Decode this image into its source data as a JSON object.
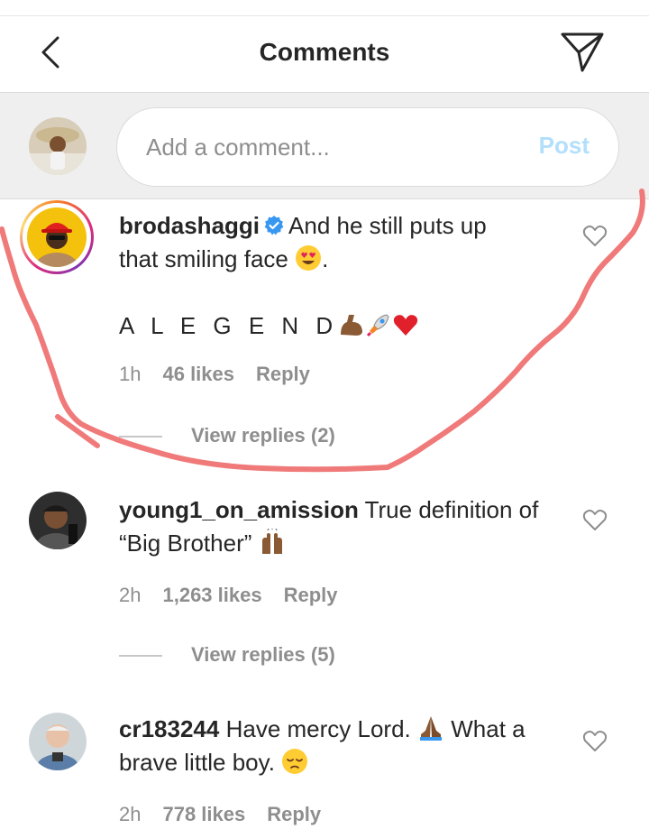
{
  "header": {
    "title": "Comments",
    "back_icon": "chevron-left-icon",
    "send_icon": "paper-plane-icon"
  },
  "composer": {
    "placeholder": "Add a comment...",
    "post_label": "Post",
    "post_color": "#b2dffc"
  },
  "comments": [
    {
      "username": "brodashaggi",
      "verified": true,
      "text_line1": "And he still puts up",
      "text_line2": "that smiling face",
      "text_line2_end": ".",
      "line2_emoji": "heart-eyes-emoji",
      "extra_text": "A L E G E N D",
      "extra_emojis": [
        "flexed-biceps-emoji",
        "rocket-emoji",
        "red-heart-emoji"
      ],
      "time": "1h",
      "likes": "46 likes",
      "reply_label": "Reply",
      "replies_label": "View replies (2)"
    },
    {
      "username": "young1_on_amission",
      "text_line1": "True definition of",
      "text_line2": "“Big Brother”",
      "line2_emoji": "raising-hands-emoji",
      "time": "2h",
      "likes": "1,263 likes",
      "reply_label": "Reply",
      "replies_label": "View replies (5)"
    },
    {
      "username": "cr183244",
      "text_line1": "Have mercy Lord.",
      "text_line1_after": "What a",
      "line1_emoji": "folded-hands-emoji",
      "text_line2": "brave little boy.",
      "line2_emoji": "pensive-face-emoji",
      "time": "2h",
      "likes": "778 likes",
      "reply_label": "Reply"
    }
  ],
  "colors": {
    "text": "#262626",
    "secondary": "#8e8e8e",
    "composer_bg": "#efefef",
    "verified_blue": "#3897f0",
    "scribble": "#f08080"
  }
}
